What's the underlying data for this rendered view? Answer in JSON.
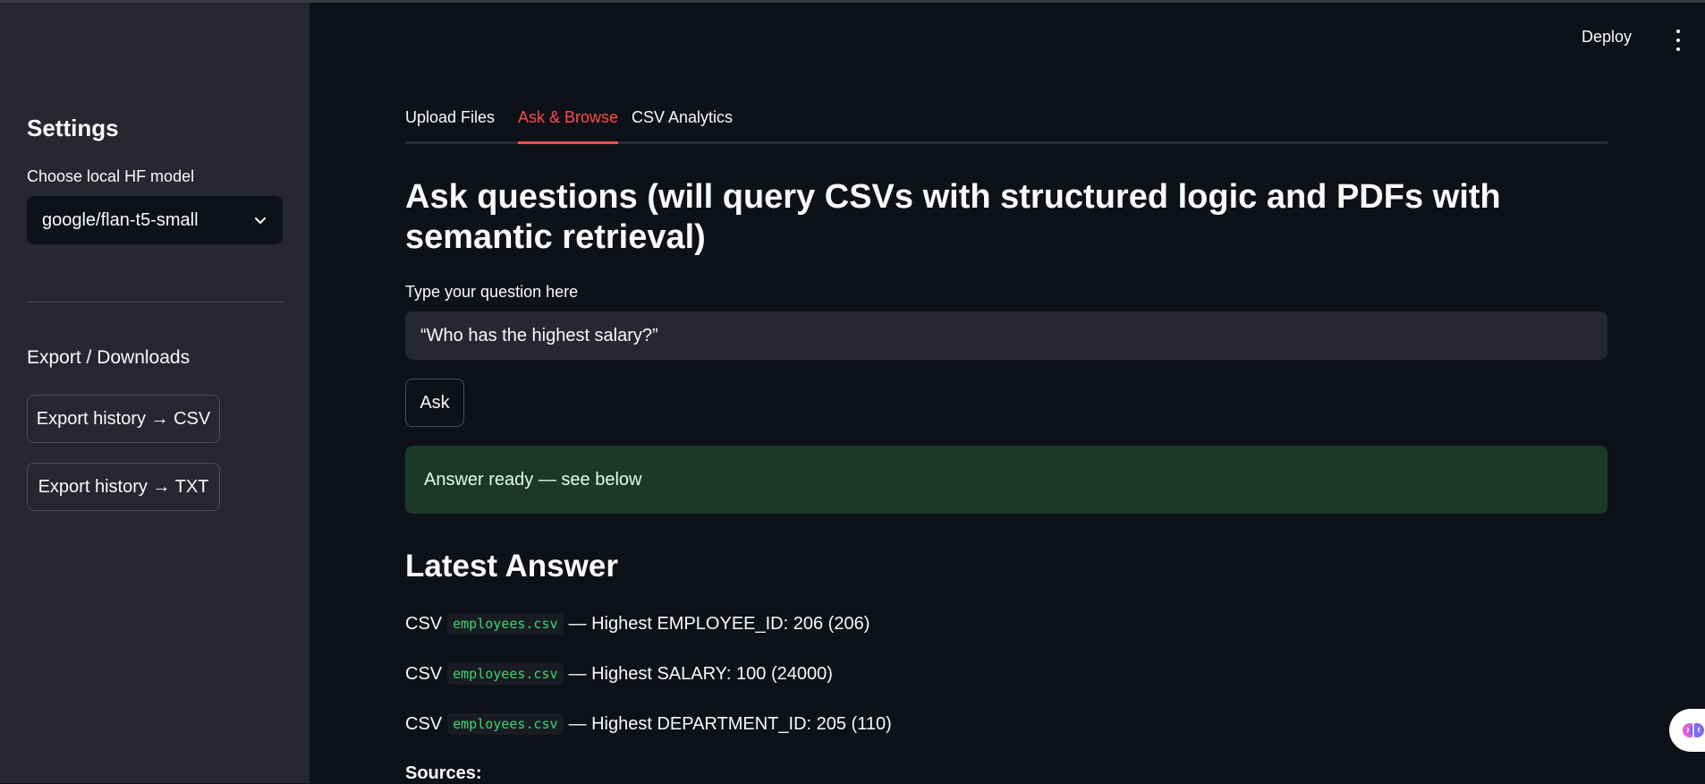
{
  "sidebar": {
    "title": "Settings",
    "model_label": "Choose local HF model",
    "model_selected": "google/flan-t5-small",
    "export_section": "Export / Downloads",
    "export_csv_label": "Export history → CSV",
    "export_txt_label": "Export history → TXT"
  },
  "header": {
    "deploy_label": "Deploy"
  },
  "tabs": [
    {
      "label": "Upload Files",
      "active": false
    },
    {
      "label": "Ask & Browse",
      "active": true
    },
    {
      "label": "CSV Analytics",
      "active": false
    }
  ],
  "main": {
    "heading": "Ask questions (will query CSVs with structured logic and PDFs with semantic retrieval)",
    "question_label": "Type your question here",
    "question_value": "“Who has the highest salary?”",
    "ask_label": "Ask",
    "alert_text": "Answer ready — see below",
    "latest_heading": "Latest Answer",
    "answers": [
      {
        "prefix": "CSV",
        "file": "employees.csv",
        "text": "— Highest EMPLOYEE_ID: 206 (206)"
      },
      {
        "prefix": "CSV",
        "file": "employees.csv",
        "text": "— Highest SALARY: 100 (24000)"
      },
      {
        "prefix": "CSV",
        "file": "employees.csv",
        "text": "— Highest DEPARTMENT_ID: 205 (110)"
      }
    ],
    "sources_label": "Sources:"
  },
  "colors": {
    "accent": "#ff4b4b",
    "success_bg": "#1c3829",
    "code_text": "#3dd56d"
  }
}
